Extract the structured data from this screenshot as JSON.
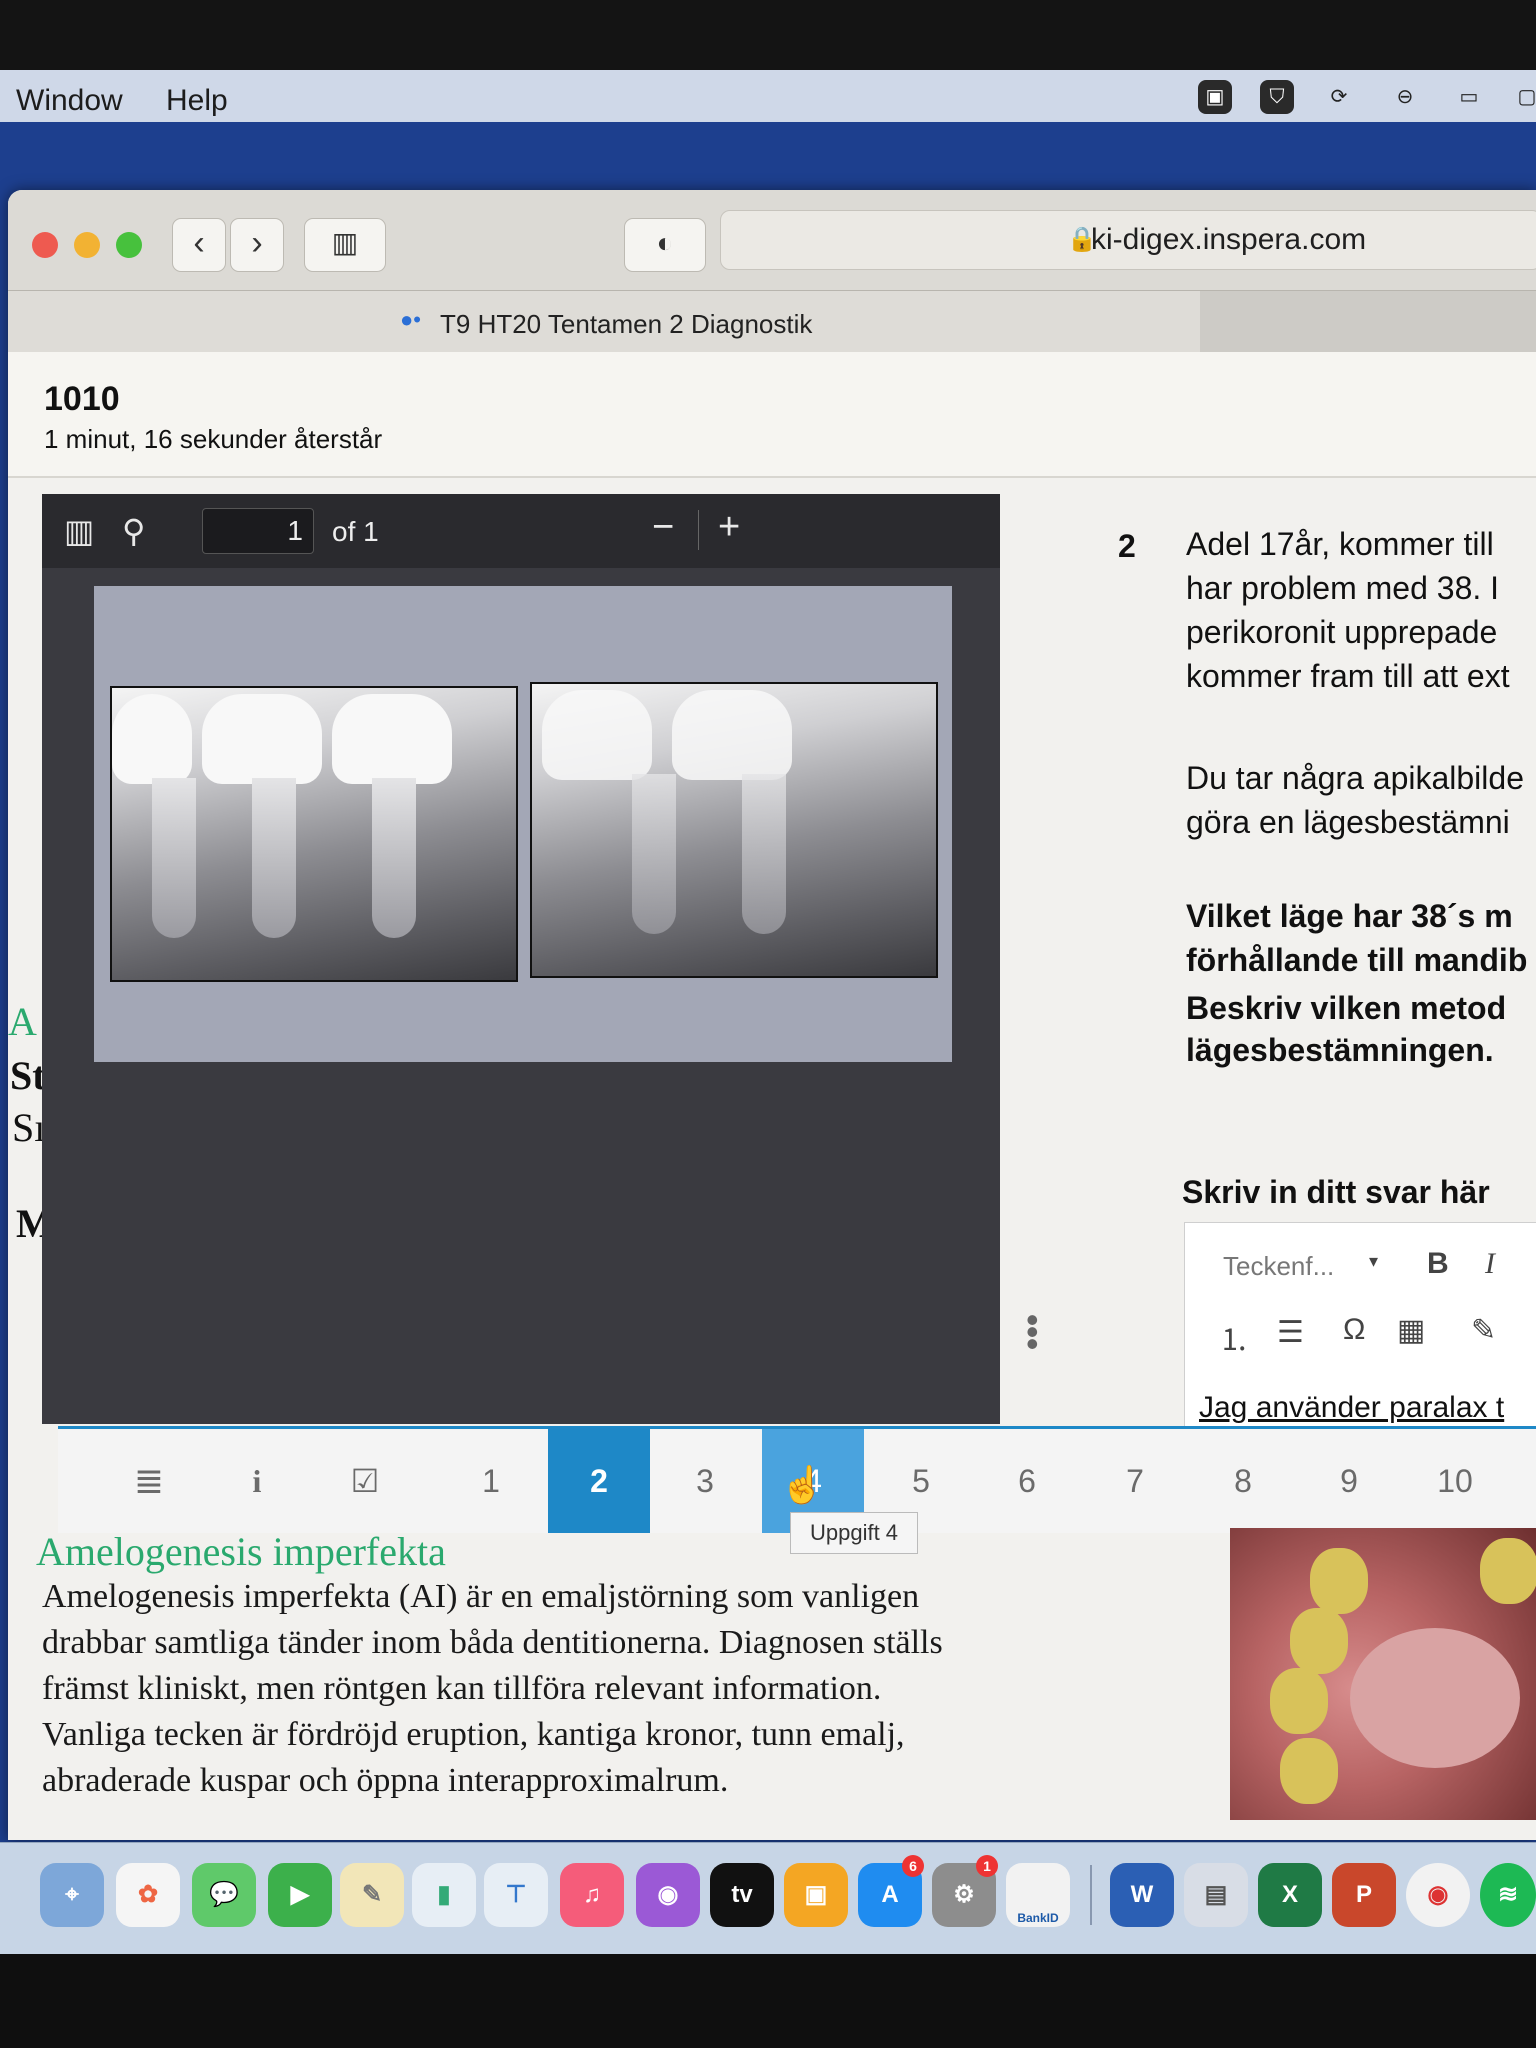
{
  "menubar": {
    "items": [
      "Window",
      "Help"
    ]
  },
  "browser": {
    "url": "ki-digex.inspera.com",
    "tab_title": "T9 HT20 Tentamen 2 Diagnostik"
  },
  "exam": {
    "candidate_id": "1010",
    "time_remaining": "1 minut, 16 sekunder återstår"
  },
  "pdf_viewer": {
    "page_current": "1",
    "page_total_label": "of 1",
    "zoom_out": "−",
    "zoom_in": "+"
  },
  "question": {
    "number": "2",
    "lines": [
      "Adel 17år, kommer till",
      "har problem med 38. I",
      "perikoronit upprepade",
      "kommer fram till att ext"
    ],
    "lines2": [
      "Du tar några apikalbilde",
      "göra en lägesbestämni"
    ],
    "bold_lines": [
      "Vilket läge har 38´s m",
      "förhållande till mandib",
      "Beskriv vilken metod",
      "lägesbestämningen."
    ],
    "answer_label": "Skriv in ditt svar här",
    "editor": {
      "font_placeholder": "Teckenf...",
      "bold": "B",
      "italic": "I",
      "answer_text": "Jag använder paralax t"
    }
  },
  "navigation": {
    "icons": [
      "≣",
      "i",
      "☑"
    ],
    "pages": [
      "1",
      "2",
      "3",
      "4",
      "5",
      "6",
      "7",
      "8",
      "9",
      "10"
    ],
    "active_page": "2",
    "hover_tooltip": "Uppgift 4"
  },
  "background_page": {
    "left_letters": [
      "A",
      "St",
      "Sı",
      "M"
    ],
    "article_title": "Amelogenesis imperfekta",
    "paragraph": [
      "Amelogenesis imperfekta (AI) är en emaljstörning som vanligen",
      "drabbar samtliga tänder inom båda dentitionerna. Diagnosen ställs",
      "främst kliniskt, men röntgen kan tillföra relevant information.",
      "Vanliga tecken är fördröjd eruption, kantiga kronor, tunn emalj,",
      "abraderade kuspar och öppna interapproximalrum."
    ]
  },
  "dock": {
    "badges": [
      "6",
      "1"
    ],
    "bankid_label": "BankID",
    "tv_label": "tv"
  },
  "colors": {
    "accent": "#1e88c7",
    "article_title": "#2aa96e",
    "desktop": "#1d3f8e"
  }
}
